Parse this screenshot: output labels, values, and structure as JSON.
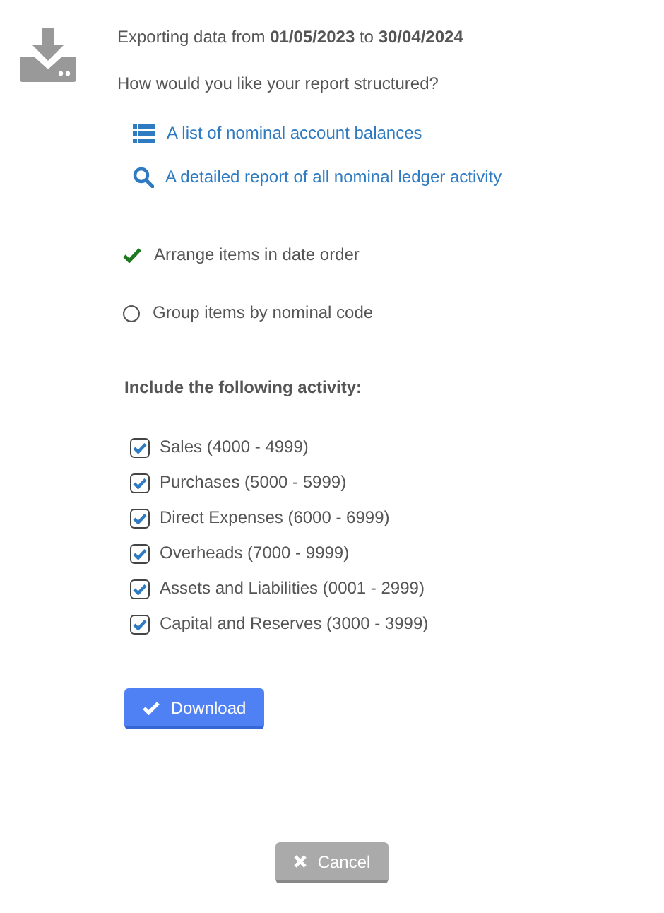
{
  "intro": "Exporting data from **01/05/2023** to **30/04/2024**",
  "question": "How would you like your report structured?",
  "report_types": [
    {
      "kind": "list",
      "label": "A list of nominal account balances"
    },
    {
      "kind": "search",
      "label": "A detailed report of all nominal ledger activity"
    }
  ],
  "order_options": [
    {
      "label": "Arrange items in date order",
      "selected": true
    },
    {
      "label": "Group items by nominal code",
      "selected": false
    }
  ],
  "activity_heading": "Include the following activity:",
  "activities": [
    {
      "label": "Sales (4000 - 4999)",
      "checked": true
    },
    {
      "label": "Purchases (5000 - 5999)",
      "checked": true
    },
    {
      "label": "Direct Expenses (6000 - 6999)",
      "checked": true
    },
    {
      "label": "Overheads (7000 - 9999)",
      "checked": true
    },
    {
      "label": "Assets and Liabilities (0001 - 2999)",
      "checked": true
    },
    {
      "label": "Capital and Reserves (3000 - 3999)",
      "checked": true
    }
  ],
  "download_button": "Download",
  "cancel_button": "Cancel"
}
